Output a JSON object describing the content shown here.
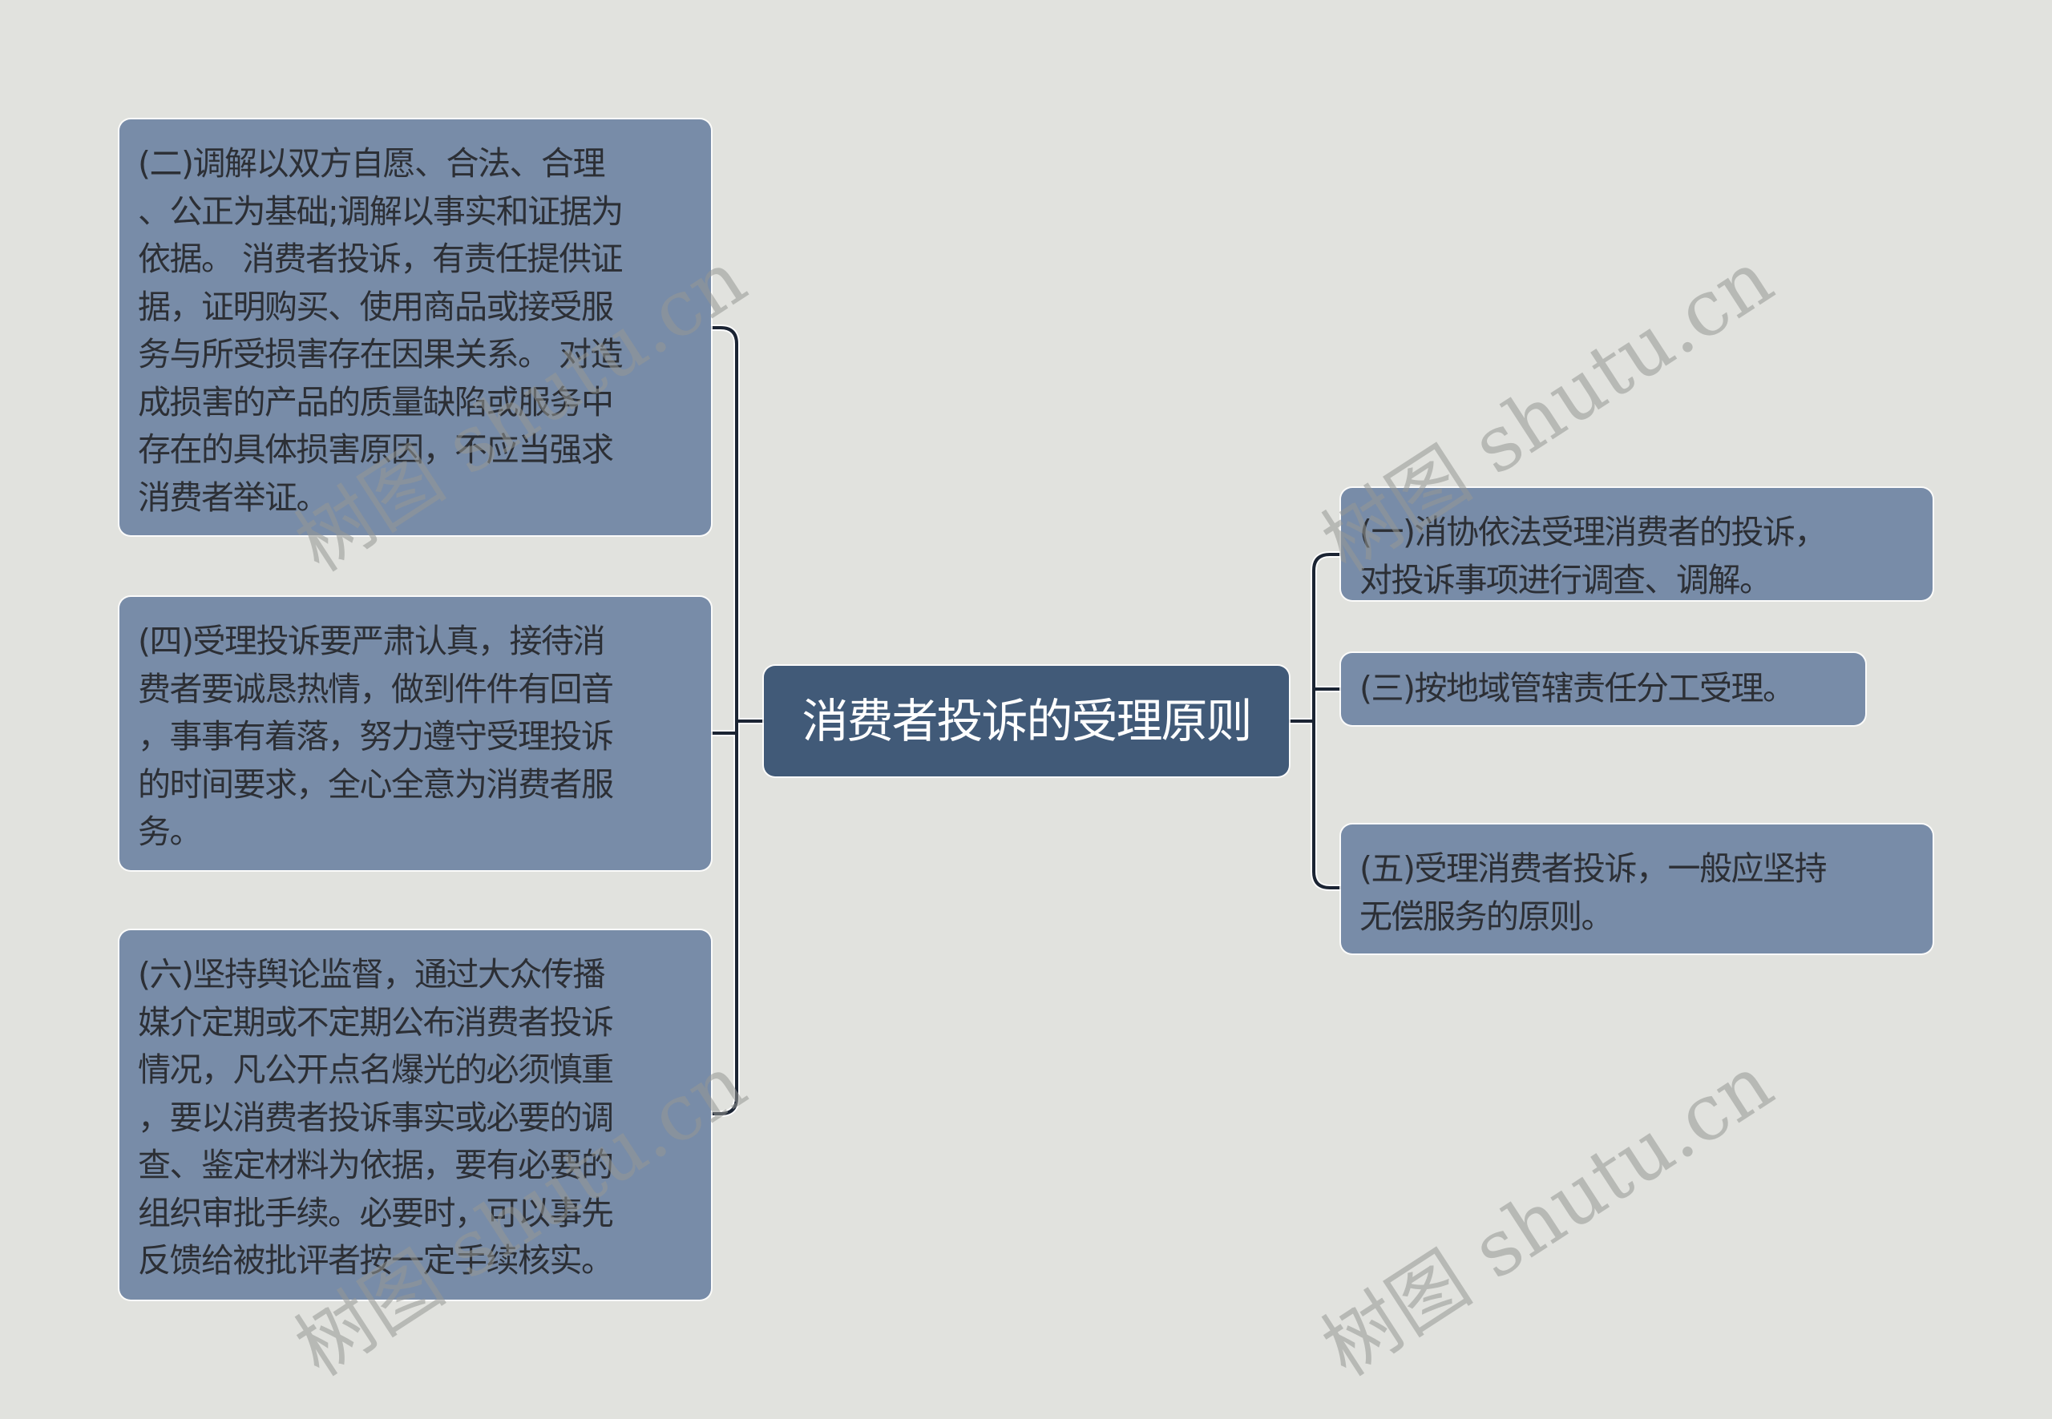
{
  "diagram": {
    "type": "mind-map",
    "root": {
      "label": "消费者投诉的受理原则"
    },
    "left_branches": [
      {
        "id": "2",
        "lines": [
          "(二)调解以双方自愿、合法、合理",
          "、公正为基础;调解以事实和证据为",
          "依据。 消费者投诉，有责任提供证",
          "据，证明购买、使用商品或接受服",
          "务与所受损害存在因果关系。 对造",
          "成损害的产品的质量缺陷或服务中",
          "存在的具体损害原因，不应当强求",
          "消费者举证。"
        ]
      },
      {
        "id": "4",
        "lines": [
          "(四)受理投诉要严肃认真，接待消",
          "费者要诚恳热情，做到件件有回音",
          "，事事有着落，努力遵守受理投诉",
          "的时间要求，全心全意为消费者服",
          "务。"
        ]
      },
      {
        "id": "6",
        "lines": [
          "(六)坚持舆论监督，通过大众传播",
          "媒介定期或不定期公布消费者投诉",
          "情况，凡公开点名爆光的必须慎重",
          "，要以消费者投诉事实或必要的调",
          "查、鉴定材料为依据，要有必要的",
          "组织审批手续。必要时，可以事先",
          "反馈给被批评者按一定手续核实。"
        ]
      }
    ],
    "right_branches": [
      {
        "id": "1",
        "lines": [
          "(一)消协依法受理消费者的投诉，",
          "对投诉事项进行调查、调解。"
        ]
      },
      {
        "id": "3",
        "lines": [
          "(三)按地域管辖责任分工受理。"
        ]
      },
      {
        "id": "5",
        "lines": [
          "(五)受理消费者投诉，一般应坚持",
          "无偿服务的原则。"
        ]
      }
    ]
  },
  "colors": {
    "background": "#e1e2de",
    "root_fill": "#415a78",
    "child_fill": "#788ca8",
    "connector": "#1b2433",
    "text_dark": "#2c2f35"
  },
  "watermark": {
    "text": "树图 shutu.cn"
  }
}
